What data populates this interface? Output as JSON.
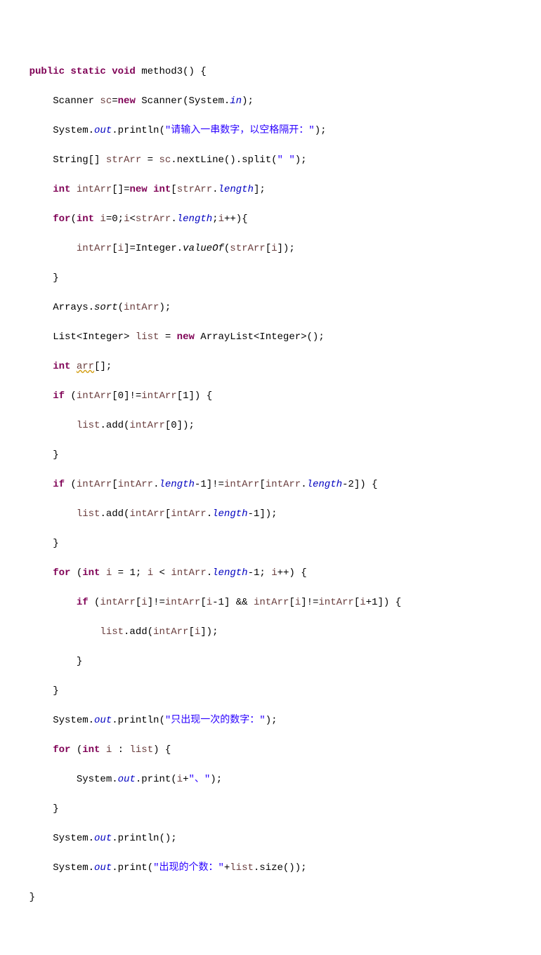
{
  "code": {
    "l1a": "public static void",
    "l1b": " method3() {",
    "l2a": "        Scanner ",
    "l2b": "sc",
    "l2c": "=",
    "l2d": "new",
    "l2e": " Scanner(System.",
    "l2f": "in",
    "l2g": ");",
    "l3a": "        System.",
    "l3b": "out",
    "l3c": ".println(",
    "l3d": "\"请输入一串数字，以空格隔开：\"",
    "l3e": ");",
    "l4a": "        String[] ",
    "l4b": "strArr",
    "l4c": " = ",
    "l4d": "sc",
    "l4e": ".nextLine().split(",
    "l4f": "\" \"",
    "l4g": ");",
    "l5a": "        ",
    "l5b": "int",
    "l5c": " ",
    "l5d": "intArr",
    "l5e": "[]=",
    "l5f": "new int",
    "l5g": "[",
    "l5h": "strArr",
    "l5i": ".",
    "l5j": "length",
    "l5k": "];",
    "l6a": "        ",
    "l6b": "for",
    "l6c": "(",
    "l6d": "int",
    "l6e": " ",
    "l6f": "i",
    "l6g": "=0;",
    "l6h": "i",
    "l6i": "<",
    "l6j": "strArr",
    "l6k": ".",
    "l6l": "length",
    "l6m": ";",
    "l6n": "i",
    "l6o": "++){",
    "l7a": "            ",
    "l7b": "intArr",
    "l7c": "[",
    "l7d": "i",
    "l7e": "]=Integer.",
    "l7f": "valueOf",
    "l7g": "(",
    "l7h": "strArr",
    "l7i": "[",
    "l7j": "i",
    "l7k": "]);",
    "l8": "        }",
    "l9a": "        Arrays.",
    "l9b": "sort",
    "l9c": "(",
    "l9d": "intArr",
    "l9e": ");",
    "l10a": "        List<Integer> ",
    "l10b": "list",
    "l10c": " = ",
    "l10d": "new",
    "l10e": " ArrayList<Integer>();",
    "l11a": "        ",
    "l11b": "int",
    "l11c": " ",
    "l11d": "arr",
    "l11e": "[];",
    "l12a": "        ",
    "l12b": "if",
    "l12c": " (",
    "l12d": "intArr",
    "l12e": "[0]!=",
    "l12f": "intArr",
    "l12g": "[1]) {",
    "l13a": "            ",
    "l13b": "list",
    "l13c": ".add(",
    "l13d": "intArr",
    "l13e": "[0]);",
    "l14": "        }",
    "l15a": "        ",
    "l15b": "if",
    "l15c": " (",
    "l15d": "intArr",
    "l15e": "[",
    "l15f": "intArr",
    "l15g": ".",
    "l15h": "length",
    "l15i": "-1]!=",
    "l15j": "intArr",
    "l15k": "[",
    "l15l": "intArr",
    "l15m": ".",
    "l15n": "length",
    "l15o": "-2]) {",
    "l16a": "            ",
    "l16b": "list",
    "l16c": ".add(",
    "l16d": "intArr",
    "l16e": "[",
    "l16f": "intArr",
    "l16g": ".",
    "l16h": "length",
    "l16i": "-1]);",
    "l17": "        }",
    "l18a": "        ",
    "l18b": "for",
    "l18c": " (",
    "l18d": "int",
    "l18e": " ",
    "l18f": "i",
    "l18g": " = 1; ",
    "l18h": "i",
    "l18i": " < ",
    "l18j": "intArr",
    "l18k": ".",
    "l18l": "length",
    "l18m": "-1; ",
    "l18n": "i",
    "l18o": "++) {",
    "l19a": "            ",
    "l19b": "if",
    "l19c": " (",
    "l19d": "intArr",
    "l19e": "[",
    "l19f": "i",
    "l19g": "]!=",
    "l19h": "intArr",
    "l19i": "[",
    "l19j": "i",
    "l19k": "-1] && ",
    "l19l": "intArr",
    "l19m": "[",
    "l19n": "i",
    "l19o": "]!=",
    "l19p": "intArr",
    "l19q": "[",
    "l19r": "i",
    "l19s": "+1]) {",
    "l20a": "                ",
    "l20b": "list",
    "l20c": ".add(",
    "l20d": "intArr",
    "l20e": "[",
    "l20f": "i",
    "l20g": "]);",
    "l21": "            }",
    "l22": "        }",
    "l23a": "        System.",
    "l23b": "out",
    "l23c": ".println(",
    "l23d": "\"只出现一次的数字：\"",
    "l23e": ");",
    "l24a": "        ",
    "l24b": "for",
    "l24c": " (",
    "l24d": "int",
    "l24e": " ",
    "l24f": "i",
    "l24g": " : ",
    "l24h": "list",
    "l24i": ") {",
    "l25a": "            System.",
    "l25b": "out",
    "l25c": ".print(",
    "l25d": "i",
    "l25e": "+",
    "l25f": "\"、\"",
    "l25g": ");",
    "l26": "        }",
    "l27a": "        System.",
    "l27b": "out",
    "l27c": ".println();",
    "l28a": "        System.",
    "l28b": "out",
    "l28c": ".print(",
    "l28d": "\"出现的个数：\"",
    "l28e": "+",
    "l28f": "list",
    "l28g": ".size());",
    "l29": "    }"
  }
}
